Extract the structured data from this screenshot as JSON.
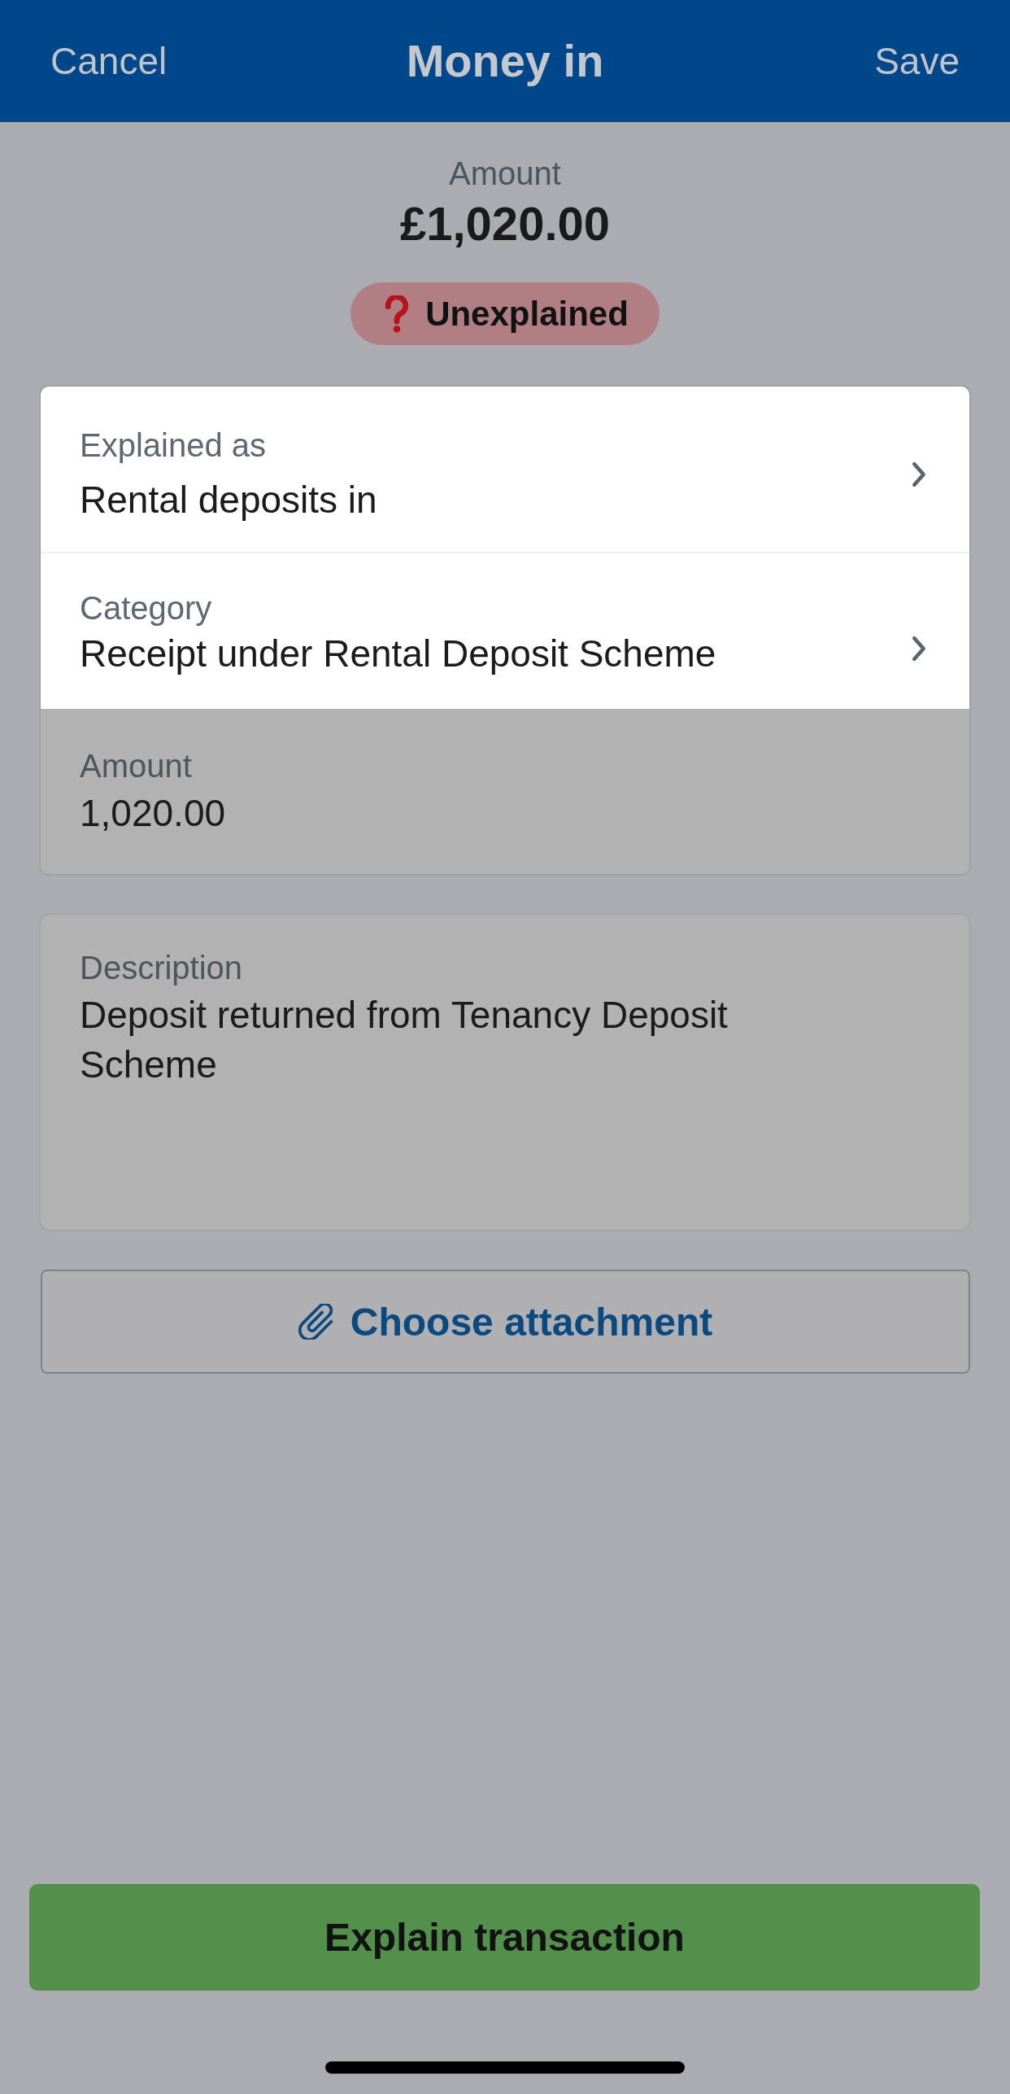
{
  "header": {
    "cancel": "Cancel",
    "title": "Money in",
    "save": "Save"
  },
  "summary": {
    "label": "Amount",
    "value": "£1,020.00"
  },
  "status_badge": {
    "label": "Unexplained"
  },
  "details": [
    {
      "kind": "link",
      "label": "Explained as",
      "value": "Rental deposits in",
      "highlighted": true
    },
    {
      "kind": "link",
      "label": "Category",
      "value": "Receipt under Rental Deposit Scheme",
      "highlighted": true
    },
    {
      "kind": "field",
      "label": "Amount",
      "value": "1,020.00",
      "highlighted": false
    }
  ],
  "description": {
    "label": "Description",
    "value": "Deposit returned from Tenancy Deposit Scheme"
  },
  "attachment_button": {
    "label": "Choose attachment"
  },
  "explain_button": {
    "label": "Explain transaction"
  }
}
